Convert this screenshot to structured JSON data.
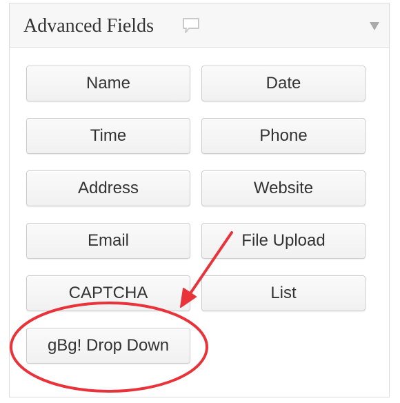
{
  "panel": {
    "title": "Advanced Fields"
  },
  "icons": {
    "tooltip": "speech-bubble-icon",
    "toggle": "triangle-down-icon"
  },
  "buttons": {
    "name": "Name",
    "date": "Date",
    "time": "Time",
    "phone": "Phone",
    "address": "Address",
    "website": "Website",
    "email": "Email",
    "file_upload": "File Upload",
    "captcha": "CAPTCHA",
    "list": "List",
    "gbg_drop_down": "gBg! Drop Down"
  },
  "colors": {
    "annotation": "#e8333a",
    "button_text": "#333333",
    "header_bg": "#f7f7f7"
  }
}
